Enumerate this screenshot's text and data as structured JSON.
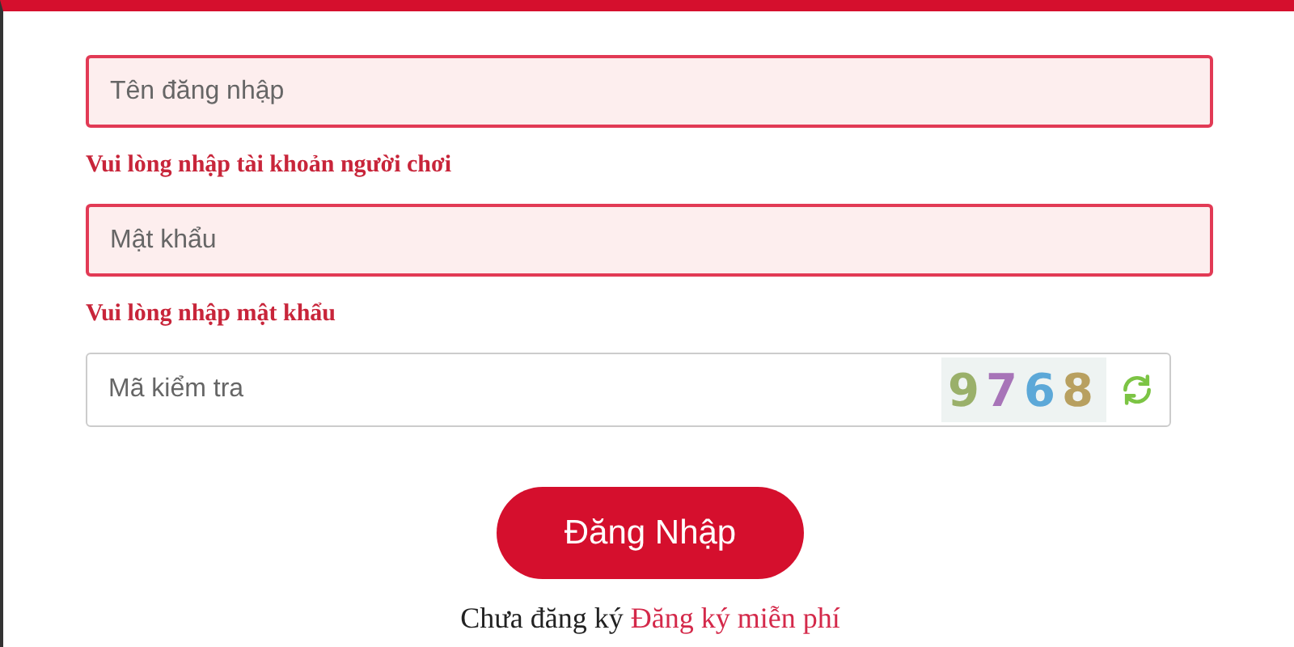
{
  "fields": [
    {
      "kind": "text",
      "placeholder": "Tên đăng nhập",
      "invalid": true,
      "error": "Vui lòng nhập tài khoản người chơi"
    },
    {
      "kind": "text",
      "placeholder": "Mật khẩu",
      "invalid": true,
      "error": "Vui lòng nhập mật khẩu"
    },
    {
      "kind": "captcha",
      "placeholder": "Mã kiểm tra",
      "invalid": false,
      "captcha_code": "9768"
    }
  ],
  "login_button": "Đăng Nhập",
  "footer": {
    "text": "Chưa đăng ký",
    "link": "Đăng ký miễn phí"
  }
}
